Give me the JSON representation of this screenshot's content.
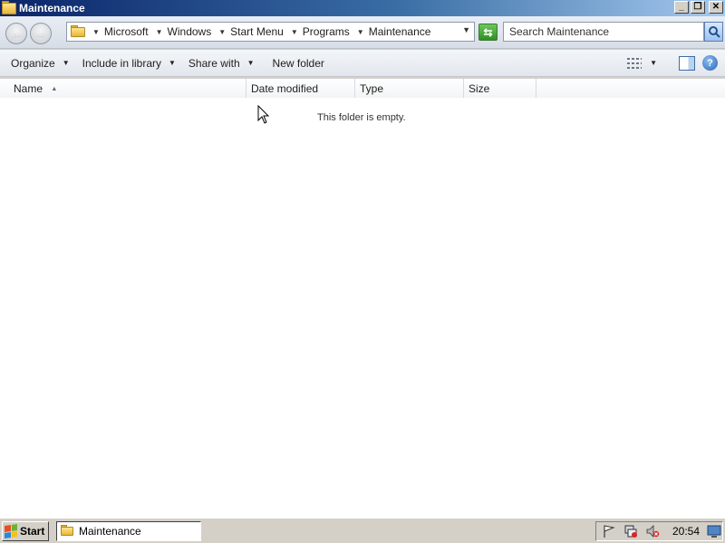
{
  "window": {
    "title": "Maintenance",
    "minimize_glyph": "_",
    "restore_glyph": "❐",
    "close_glyph": "✕"
  },
  "address": {
    "breadcrumbs": [
      "Microsoft",
      "Windows",
      "Start Menu",
      "Programs",
      "Maintenance"
    ],
    "search_placeholder": "Search Maintenance"
  },
  "toolbar": {
    "organize_label": "Organize",
    "include_label": "Include in library",
    "share_label": "Share with",
    "new_folder_label": "New folder"
  },
  "columns": {
    "name": "Name",
    "date": "Date modified",
    "type": "Type",
    "size": "Size"
  },
  "content": {
    "empty_message": "This folder is empty."
  },
  "taskbar": {
    "start_label": "Start",
    "task_label": "Maintenance",
    "clock": "20:54"
  },
  "icons": {
    "folder": "folder-icon",
    "back": "back-arrow-icon",
    "forward": "forward-arrow-icon",
    "refresh": "refresh-icon",
    "search": "search-icon",
    "views": "views-icon",
    "preview_pane": "preview-pane-icon",
    "help": "help-icon",
    "flag": "action-center-flag-icon",
    "network": "network-icon",
    "volume": "volume-muted-icon",
    "desktop": "show-desktop-icon"
  }
}
